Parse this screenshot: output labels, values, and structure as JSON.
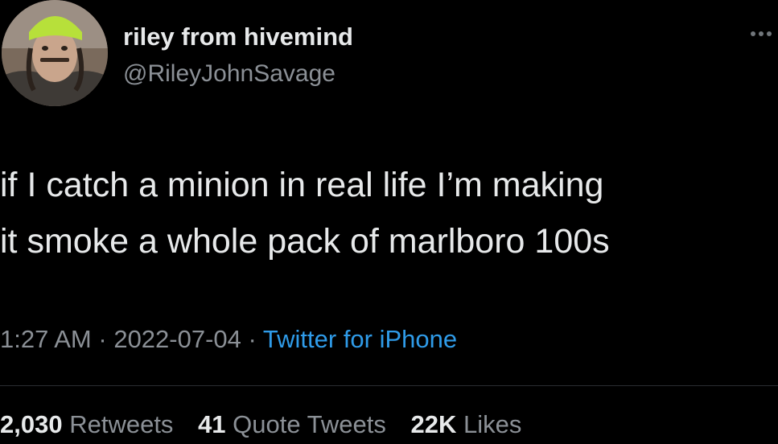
{
  "author": {
    "name": "riley from hivemind",
    "handle": "@RileyJohnSavage"
  },
  "tweet": {
    "lines": [
      "if I catch a minion in real life I’m making",
      "it smoke a whole pack of marlboro 100s"
    ]
  },
  "meta": {
    "time": "1:27 AM",
    "separator": "·",
    "date": "2022-07-04",
    "source": "Twitter for iPhone"
  },
  "stats": {
    "retweets_count": "2,030",
    "retweets_label": "Retweets",
    "quotes_count": "41",
    "quotes_label": "Quote Tweets",
    "likes_count": "22K",
    "likes_label": "Likes"
  },
  "colors": {
    "background": "#000000",
    "primary_text": "#e7e9ea",
    "secondary_text": "#8b9096",
    "link": "#2f9be8"
  },
  "icons": {
    "more": "more-horizontal-icon"
  }
}
